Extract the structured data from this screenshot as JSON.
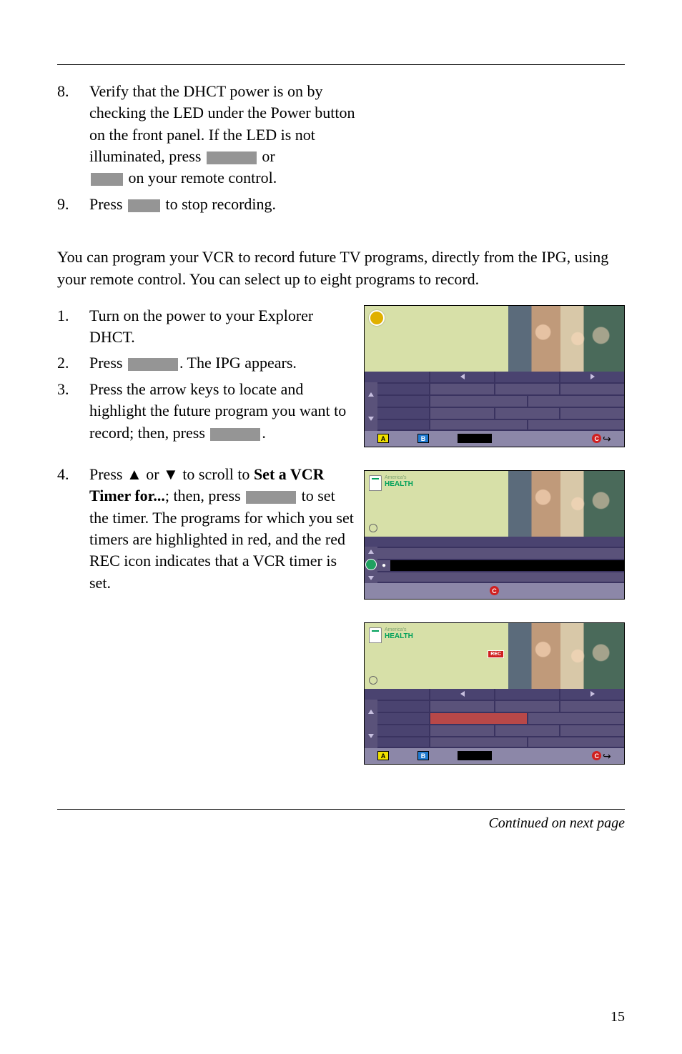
{
  "top_section": {
    "item8": {
      "num": "8.",
      "text_a": "Verify that the DHCT power is on by checking the LED under the Power button on the front panel. If the LED is not illuminated, press ",
      "text_b": " or ",
      "text_c": " on your remote control."
    },
    "item9": {
      "num": "9.",
      "text_a": "Press ",
      "text_b": " to stop recording."
    }
  },
  "intro_paragraph": "You can program your VCR to record future TV programs, directly from the IPG, using your remote control. You can select up to eight programs to record.",
  "steps": {
    "s1": {
      "num": "1.",
      "text": "Turn on the power to your Explorer DHCT."
    },
    "s2": {
      "num": "2.",
      "text_a": "Press ",
      "text_b": ". The IPG appears."
    },
    "s3": {
      "num": "3.",
      "text_a": "Press the arrow keys to locate and highlight the future program you want to record; then, press ",
      "text_b": "."
    },
    "s4": {
      "num": "4.",
      "text_a": "Press ▲ or ▼ to scroll to ",
      "bold": "Set a VCR Timer for...",
      "text_b": "; then, press ",
      "text_c": " to set the timer. The programs for which you set timers are highlighted in red, and the red REC icon indicates that a VCR timer is set."
    }
  },
  "ipg": {
    "health": "HEALTH",
    "americas": "America's",
    "rec": "REC",
    "A": "A",
    "B": "B",
    "C": "C"
  },
  "continued": "Continued on next page",
  "page_number": "15"
}
